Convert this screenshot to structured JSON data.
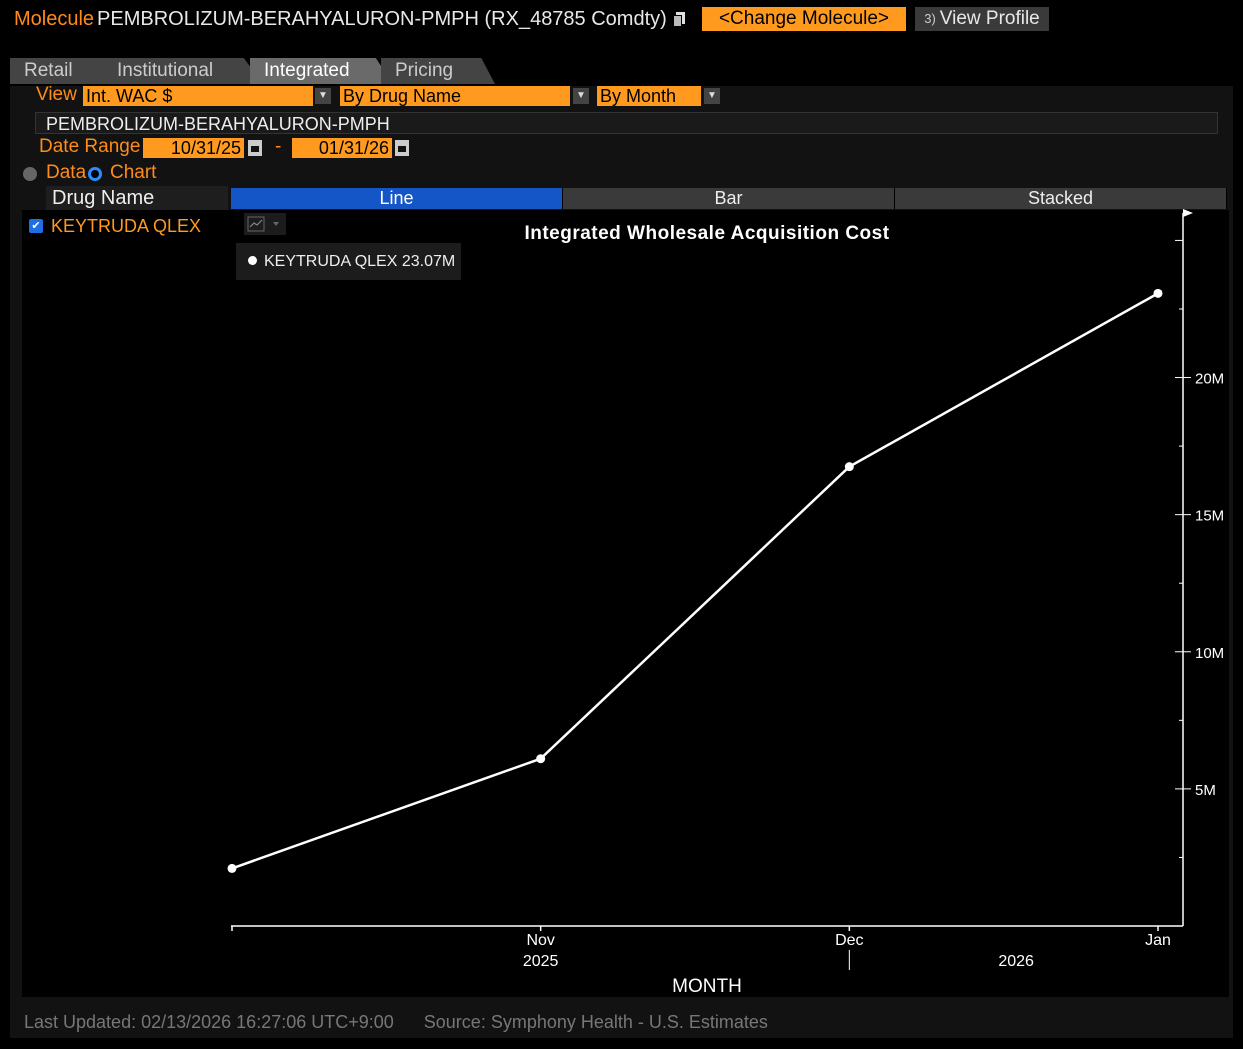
{
  "header": {
    "molecule_label": "Molecule",
    "title": "PEMBROLIZUM-BERAHYALURON-PMPH (RX_48785 Comdty)",
    "change_button": "<Change Molecule>",
    "profile_num": "3)",
    "profile_button": "View Profile"
  },
  "tabs": [
    "Retail",
    "Institutional",
    "Integrated",
    "Pricing"
  ],
  "active_tab": "Integrated",
  "controls": {
    "view_label": "View",
    "view_value": "Int. WAC $",
    "group_value": "By Drug Name",
    "period_value": "By Month",
    "molecule_name": "PEMBROLIZUM-BERAHYALURON-PMPH",
    "date_range_label": "Date Range",
    "date_from": "10/31/25",
    "date_sep": "-",
    "date_to": "01/31/26",
    "radio_data": "Data",
    "radio_chart": "Chart"
  },
  "table": {
    "header": "Drug Name",
    "drug": "KEYTRUDA QLEX"
  },
  "modes": [
    "Line",
    "Bar",
    "Stacked"
  ],
  "selected_mode": "Line",
  "legend": {
    "series": "KEYTRUDA QLEX",
    "value": "23.07M"
  },
  "chart_data": {
    "type": "line",
    "title": "Integrated Wholesale Acquisition Cost",
    "xlabel": "MONTH",
    "ylabel": "",
    "x": [
      "2025-10",
      "2025-11",
      "2025-12",
      "2026-01"
    ],
    "x_tick_labels": [
      {
        "month": "Nov",
        "year": "2025"
      },
      {
        "month": "Dec",
        "year": ""
      },
      {
        "month": "Jan",
        "year": ""
      }
    ],
    "year_labels": [
      "2026"
    ],
    "series": [
      {
        "name": "KEYTRUDA QLEX",
        "values": [
          2.1,
          6.1,
          16.75,
          23.07
        ]
      }
    ],
    "y_unit": "M",
    "ylim": [
      0,
      26
    ],
    "y_ticks": [
      5,
      10,
      15,
      20
    ],
    "y_tick_labels": [
      "5M",
      "10M",
      "15M",
      "20M"
    ],
    "y_axis_side": "right",
    "grid": false,
    "colors": {
      "line": "#ffffff",
      "background": "#000000"
    }
  },
  "footer": {
    "last_updated": "Last Updated: 02/13/2026 16:27:06 UTC+9:00",
    "source": "Source: Symphony Health - U.S. Estimates"
  },
  "colors": {
    "accent": "#ff9a1f",
    "selected": "#1455c7"
  }
}
